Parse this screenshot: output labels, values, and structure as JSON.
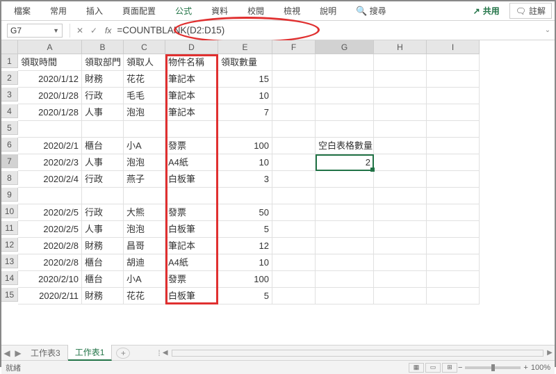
{
  "ribbon": {
    "tabs": [
      "檔案",
      "常用",
      "插入",
      "頁面配置",
      "公式",
      "資料",
      "校閱",
      "檢視",
      "說明"
    ],
    "search": "搜尋",
    "share": "共用",
    "comment": "註解"
  },
  "fxbar": {
    "namebox": "G7",
    "formula": "=COUNTBLANK(D2:D15)"
  },
  "columns": [
    "A",
    "B",
    "C",
    "D",
    "E",
    "F",
    "G",
    "H",
    "I"
  ],
  "rows": [
    "1",
    "2",
    "3",
    "4",
    "5",
    "6",
    "7",
    "8",
    "9",
    "10",
    "11",
    "12",
    "13",
    "14",
    "15"
  ],
  "headers": [
    "領取時間",
    "領取部門",
    "領取人",
    "物件名稱",
    "領取數量"
  ],
  "data": [
    {
      "a": "2020/1/12",
      "b": "財務",
      "c": "花花",
      "d": "筆記本",
      "e": "15"
    },
    {
      "a": "2020/1/28",
      "b": "行政",
      "c": "毛毛",
      "d": "筆記本",
      "e": "10"
    },
    {
      "a": "2020/1/28",
      "b": "人事",
      "c": "泡泡",
      "d": "筆記本",
      "e": "7"
    },
    {
      "a": "",
      "b": "",
      "c": "",
      "d": "",
      "e": ""
    },
    {
      "a": "2020/2/1",
      "b": "櫃台",
      "c": "小A",
      "d": "發票",
      "e": "100"
    },
    {
      "a": "2020/2/3",
      "b": "人事",
      "c": "泡泡",
      "d": "A4紙",
      "e": "10"
    },
    {
      "a": "2020/2/4",
      "b": "行政",
      "c": "燕子",
      "d": "白板筆",
      "e": "3"
    },
    {
      "a": "",
      "b": "",
      "c": "",
      "d": "",
      "e": ""
    },
    {
      "a": "2020/2/5",
      "b": "行政",
      "c": "大熊",
      "d": "發票",
      "e": "50"
    },
    {
      "a": "2020/2/5",
      "b": "人事",
      "c": "泡泡",
      "d": "白板筆",
      "e": "5"
    },
    {
      "a": "2020/2/8",
      "b": "財務",
      "c": "昌哥",
      "d": "筆記本",
      "e": "12"
    },
    {
      "a": "2020/2/8",
      "b": "櫃台",
      "c": "胡迪",
      "d": "A4紙",
      "e": "10"
    },
    {
      "a": "2020/2/10",
      "b": "櫃台",
      "c": "小A",
      "d": "發票",
      "e": "100"
    },
    {
      "a": "2020/2/11",
      "b": "財務",
      "c": "花花",
      "d": "白板筆",
      "e": "5"
    }
  ],
  "g6": "空白表格數量",
  "g7": "2",
  "tabs": {
    "items": [
      "工作表3",
      "工作表1"
    ],
    "active": 1
  },
  "status": {
    "ready": "就緒",
    "zoom": "100%"
  },
  "chart_data": null
}
